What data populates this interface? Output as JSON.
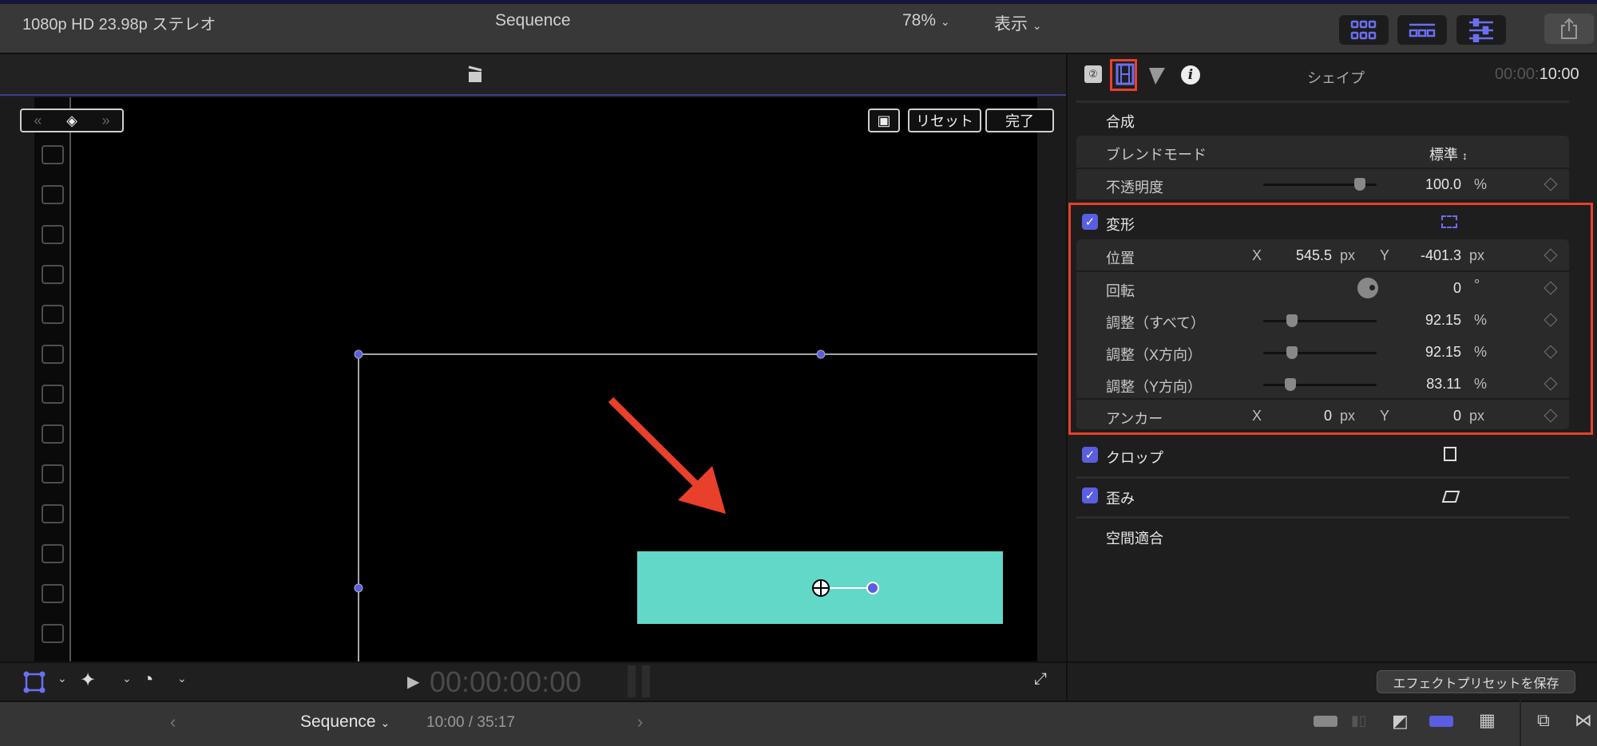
{
  "toolbar": {
    "icons": [
      "browser-grid-icon",
      "timeline-icon",
      "inspector-sliders-icon",
      "share-icon"
    ]
  },
  "viewer": {
    "format": "1080p HD 23.98p ステレオ",
    "title": "Sequence",
    "zoom": "78%",
    "view_menu": "表示",
    "reset": "リセット",
    "done": "完了",
    "timecode": "00:00:00:00"
  },
  "inspector": {
    "title": "シェイプ",
    "timecode_dim": "00:00:",
    "timecode": "10:00",
    "compositing": "合成",
    "blend_mode_label": "ブレンドモード",
    "blend_mode_value": "標準",
    "opacity_label": "不透明度",
    "opacity_value": "100.0",
    "opacity_fraction": 1.0,
    "transform": "変形",
    "position_label": "位置",
    "x": "X",
    "y": "Y",
    "px": "px",
    "pct": "%",
    "deg": "°",
    "position_x": "545.5",
    "position_y": "-401.3",
    "rotation_label": "回転",
    "rotation_value": "0",
    "scale_all_label": "調整（すべて）",
    "scale_all_value": "92.15",
    "scale_x_label": "調整（X方向）",
    "scale_x_value": "92.15",
    "scale_y_label": "調整（Y方向）",
    "scale_y_value": "83.11",
    "anchor_label": "アンカー",
    "anchor_x": "0",
    "anchor_y": "0",
    "crop": "クロップ",
    "distort": "歪み",
    "spatial_conform": "空間適合",
    "save_preset": "エフェクトプリセットを保存"
  },
  "bottom": {
    "sequence": "Sequence",
    "time": "10:00 / 35:17"
  },
  "colors": {
    "accent": "#5a5ee0",
    "shape": "#62d8c8",
    "highlight": "#e8402a"
  }
}
